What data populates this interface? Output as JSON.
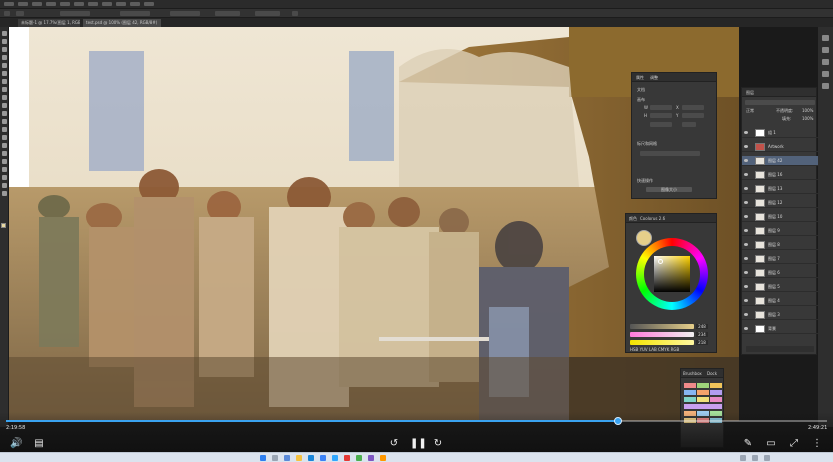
{
  "window": {
    "doc_tab_1": "未标题-1 @ 17.7%(图层 1, RGB/8#)",
    "doc_tab_2": "test.psd @ 100% (图层 42, RGB/8#)"
  },
  "properties_panel": {
    "tab_properties": "属性",
    "tab_adjust": "调整",
    "section_doc": "文档",
    "section_canvas": "画布",
    "section_align": "标尺和网格",
    "section_quick": "快速操作",
    "btn_quick": "图像大小",
    "w_label": "W",
    "h_label": "H",
    "x_label": "X",
    "y_label": "Y"
  },
  "color_panel": {
    "tab_color": "颜色",
    "tab_coolorus": "Coolorus 2.6",
    "fg_color": "#e6cf8a",
    "sliders": [
      {
        "label": "H",
        "value": "248"
      },
      {
        "label": "S",
        "value": "234"
      },
      {
        "label": "B",
        "value": "218"
      }
    ],
    "mode_row": "HSB  YUV  LAB  CMYK  RGB"
  },
  "layers_panel": {
    "tab_layers": "图层",
    "blend_mode": "正常",
    "opacity_label": "不透明度:",
    "opacity_value": "100%",
    "fill_label": "填充:",
    "fill_value": "100%",
    "layers": [
      {
        "name": "组 1",
        "selected": false,
        "thumb": "#ffffff"
      },
      {
        "name": "Artwork",
        "selected": false,
        "thumb": "#c2524a"
      },
      {
        "name": "图层 42",
        "selected": true,
        "thumb": "#e8e4dc"
      },
      {
        "name": "图层 16",
        "selected": false,
        "thumb": "#e8e4dc"
      },
      {
        "name": "图层 13",
        "selected": false,
        "thumb": "#e8e4dc"
      },
      {
        "name": "图层 12",
        "selected": false,
        "thumb": "#e8e4dc"
      },
      {
        "name": "图层 10",
        "selected": false,
        "thumb": "#e8e4dc"
      },
      {
        "name": "图层 9",
        "selected": false,
        "thumb": "#e8e4dc"
      },
      {
        "name": "图层 8",
        "selected": false,
        "thumb": "#e8e4dc"
      },
      {
        "name": "图层 7",
        "selected": false,
        "thumb": "#e8e4dc"
      },
      {
        "name": "图层 6",
        "selected": false,
        "thumb": "#e8e4dc"
      },
      {
        "name": "图层 5",
        "selected": false,
        "thumb": "#e8e4dc"
      },
      {
        "name": "图层 4",
        "selected": false,
        "thumb": "#e8e4dc"
      },
      {
        "name": "图层 3",
        "selected": false,
        "thumb": "#e8e4dc"
      },
      {
        "name": "背景",
        "selected": false,
        "thumb": "#ffffff"
      }
    ]
  },
  "swatch_panel": {
    "title": "Brushbox",
    "tab2": "Dock"
  },
  "player": {
    "current_time": "2:19:58",
    "duration": "2:49:21",
    "progress": 0.745,
    "accent": "#3aa3f0"
  },
  "icons": {
    "volume": "volume-icon",
    "subtitles": "subtitles-icon",
    "rewind": "rewind-10-icon",
    "pause": "pause-icon",
    "forward": "forward-10-icon",
    "pen": "pen-icon",
    "theater": "theater-mode-icon",
    "fullscreen": "fullscreen-icon"
  }
}
